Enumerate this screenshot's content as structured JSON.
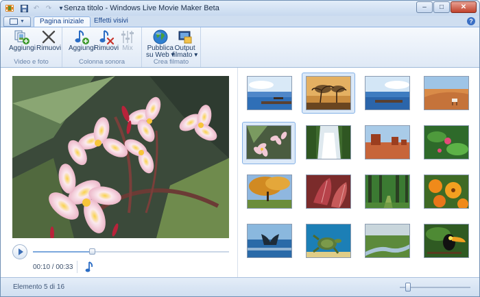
{
  "window": {
    "title": "Senza titolo - Windows Live Movie Maker Beta",
    "controls": {
      "minimize": "–",
      "maximize": "□",
      "close": "✕"
    }
  },
  "quick_access": [
    "save-icon",
    "undo-icon",
    "redo-icon",
    "customize-icon"
  ],
  "ribbon": {
    "tabs": [
      {
        "label": "Pagina iniziale",
        "active": true
      },
      {
        "label": "Effetti visivi",
        "active": false
      }
    ],
    "help_label": "?",
    "groups": [
      {
        "label": "Video e foto",
        "buttons": [
          {
            "label": "Aggiungi",
            "icon": "add-photos-icon"
          },
          {
            "label": "Rimuovi",
            "icon": "remove-icon"
          }
        ]
      },
      {
        "label": "Colonna sonora",
        "buttons": [
          {
            "label": "Aggiungi",
            "icon": "add-music-icon"
          },
          {
            "label": "Rimuovi",
            "icon": "remove-music-icon"
          },
          {
            "label": "Mix",
            "icon": "mix-icon",
            "disabled": true
          }
        ]
      },
      {
        "label": "Crea filmato",
        "buttons": [
          {
            "label_line1": "Pubblica",
            "label_line2": "su Web ▾",
            "icon": "globe-icon"
          },
          {
            "label_line1": "Output",
            "label_line2": "filmato ▾",
            "icon": "film-output-icon"
          }
        ]
      }
    ]
  },
  "player": {
    "current_time": "00:10",
    "total_time": "00:33",
    "time_display": "00:10 / 00:33",
    "progress": 0.3
  },
  "thumbnails": [
    {
      "name": "sea-dock",
      "selected": false
    },
    {
      "name": "tree-sunset",
      "selected": true
    },
    {
      "name": "sea-dock-2",
      "selected": false
    },
    {
      "name": "desert-oryx",
      "selected": false
    },
    {
      "name": "frangipani-flowers",
      "selected": true,
      "primary": true
    },
    {
      "name": "waterfall",
      "selected": false
    },
    {
      "name": "red-rock-desert",
      "selected": false
    },
    {
      "name": "green-leaves-flowers",
      "selected": false
    },
    {
      "name": "autumn-tree",
      "selected": false
    },
    {
      "name": "red-leaves",
      "selected": false
    },
    {
      "name": "forest-path",
      "selected": false
    },
    {
      "name": "orange-flowers",
      "selected": false
    },
    {
      "name": "whale-tail",
      "selected": false
    },
    {
      "name": "sea-turtle",
      "selected": false
    },
    {
      "name": "river-meadow",
      "selected": false
    },
    {
      "name": "toucan",
      "selected": false
    }
  ],
  "status": {
    "text": "Elemento 5 di 16",
    "zoom_level": 0.12
  },
  "colors": {
    "accent": "#3d6fb6",
    "ribbon_bg": "#dfe9f6",
    "title_bg": "#c7d9ef"
  }
}
